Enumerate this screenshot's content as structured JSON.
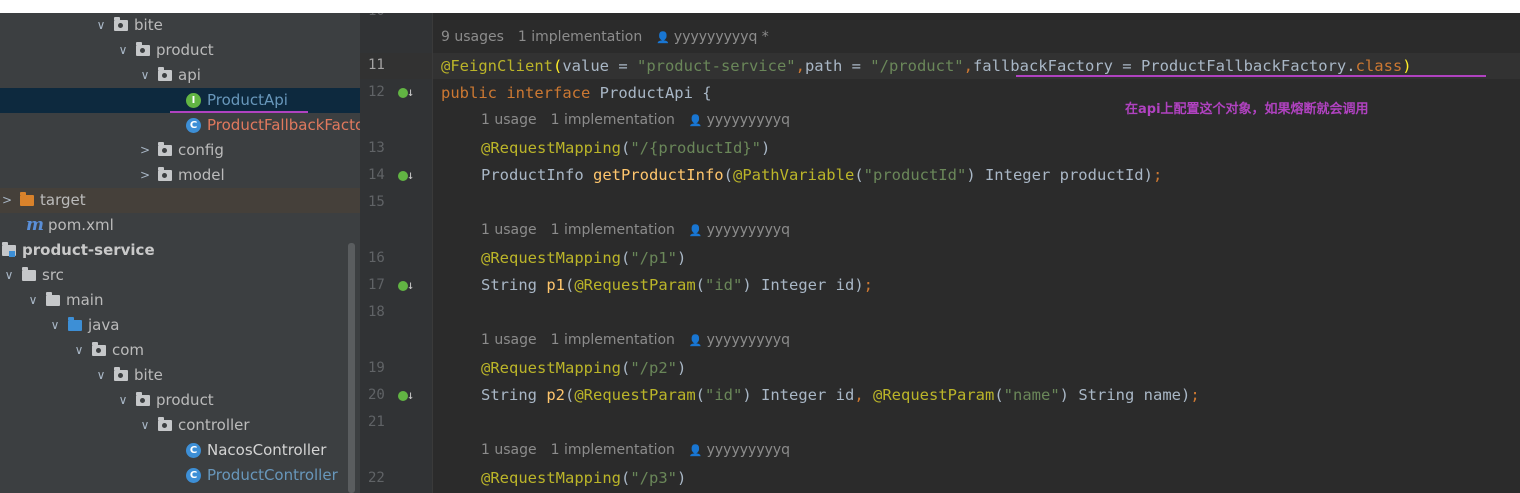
{
  "tree": {
    "items": [
      {
        "label": "bite",
        "arrow": "∨",
        "icon": "folder-pkg",
        "depth": 4
      },
      {
        "label": "product",
        "arrow": "∨",
        "icon": "folder-pkg",
        "depth": 5
      },
      {
        "label": "api",
        "arrow": "∨",
        "icon": "folder-pkg",
        "depth": 6
      },
      {
        "label": "ProductApi",
        "arrow": "",
        "icon": "interface",
        "depth": 7,
        "badge": "I"
      },
      {
        "label": "ProductFallbackFactory",
        "arrow": "",
        "icon": "class",
        "depth": 7,
        "badge": "C"
      },
      {
        "label": "config",
        "arrow": ">",
        "icon": "folder-pkg",
        "depth": 6
      },
      {
        "label": "model",
        "arrow": ">",
        "icon": "folder-pkg",
        "depth": 6
      },
      {
        "label": "target",
        "arrow": ">",
        "icon": "folder-orange",
        "depth": 0
      },
      {
        "label": "pom.xml",
        "arrow": "",
        "icon": "maven",
        "depth": 1,
        "badge": "m"
      },
      {
        "label": "product-service",
        "arrow": "",
        "icon": "module",
        "depth": 0
      },
      {
        "label": "src",
        "arrow": "∨",
        "icon": "folder",
        "depth": 0
      },
      {
        "label": "main",
        "arrow": "∨",
        "icon": "folder",
        "depth": 1
      },
      {
        "label": "java",
        "arrow": "∨",
        "icon": "folder-blue",
        "depth": 2
      },
      {
        "label": "com",
        "arrow": "∨",
        "icon": "folder-pkg",
        "depth": 3
      },
      {
        "label": "bite",
        "arrow": "∨",
        "icon": "folder-pkg",
        "depth": 4
      },
      {
        "label": "product",
        "arrow": "∨",
        "icon": "folder-pkg",
        "depth": 5
      },
      {
        "label": "controller",
        "arrow": "∨",
        "icon": "folder-pkg",
        "depth": 6
      },
      {
        "label": "NacosController",
        "arrow": "",
        "icon": "class",
        "depth": 7,
        "badge": "C"
      },
      {
        "label": "ProductController",
        "arrow": "",
        "icon": "class",
        "depth": 7,
        "badge": "C"
      }
    ]
  },
  "gutter": {
    "top_partial": "10",
    "lines": [
      "11",
      "12",
      "13",
      "14",
      "15",
      "16",
      "17",
      "18",
      "19",
      "20",
      "21",
      "22"
    ]
  },
  "hints": {
    "h1": {
      "usages": "9 usages",
      "impl": "1 implementation",
      "user": "yyyyyyyyyq *"
    },
    "h2": {
      "usages": "1 usage",
      "impl": "1 implementation",
      "user": "yyyyyyyyyq"
    },
    "h3": {
      "usages": "1 usage",
      "impl": "1 implementation",
      "user": "yyyyyyyyyq"
    },
    "h4": {
      "usages": "1 usage",
      "impl": "1 implementation",
      "user": "yyyyyyyyyq"
    },
    "h5": {
      "usages": "1 usage",
      "impl": "1 implementation",
      "user": "yyyyyyyyyq"
    }
  },
  "code": {
    "l11": {
      "ann": "@FeignClient",
      "p1": "(",
      "a1": "value = ",
      "s1": "\"product-service\"",
      "c1": ",",
      "a2": "path = ",
      "s2": "\"/product\"",
      "c2": ",",
      "a3": "fallbackFactory = ProductFallbackFactory",
      "dot": ".",
      "kw": "class",
      "p2": ")"
    },
    "l12": {
      "kw1": "public ",
      "kw2": "interface ",
      "rest": "ProductApi {"
    },
    "l13": {
      "ann": "@RequestMapping",
      "p1": "(",
      "s": "\"/{productId}\"",
      "p2": ")"
    },
    "l14": {
      "t1": "ProductInfo ",
      "fn": "getProductInfo",
      "p1": "(",
      "ann": "@PathVariable",
      "p2": "(",
      "s": "\"productId\"",
      "p3": ") Integer productId)",
      "semi": ";"
    },
    "l16": {
      "ann": "@RequestMapping",
      "p1": "(",
      "s": "\"/p1\"",
      "p2": ")"
    },
    "l17": {
      "t1": "String ",
      "fn": "p1",
      "p1": "(",
      "ann": "@RequestParam",
      "p2": "(",
      "s": "\"id\"",
      "p3": ") Integer id)",
      "semi": ";"
    },
    "l19": {
      "ann": "@RequestMapping",
      "p1": "(",
      "s": "\"/p2\"",
      "p2": ")"
    },
    "l20": {
      "t1": "String ",
      "fn": "p2",
      "p1": "(",
      "ann1": "@RequestParam",
      "p2": "(",
      "s1": "\"id\"",
      "p3": ") Integer id",
      "c": ", ",
      "ann2": "@RequestParam",
      "p4": "(",
      "s2": "\"name\"",
      "p5": ") String name)",
      "semi": ";"
    },
    "l22": {
      "ann": "@RequestMapping",
      "p1": "(",
      "s": "\"/p3\"",
      "p2": ")"
    }
  },
  "annotation_note": "在api上配置这个对象，如果熔断就会调用",
  "colors": {
    "annotation_purple": "#b042c0",
    "keyword": "#cc7832",
    "string": "#6a8759",
    "annotation": "#bbb529",
    "function": "#ffc66d"
  }
}
